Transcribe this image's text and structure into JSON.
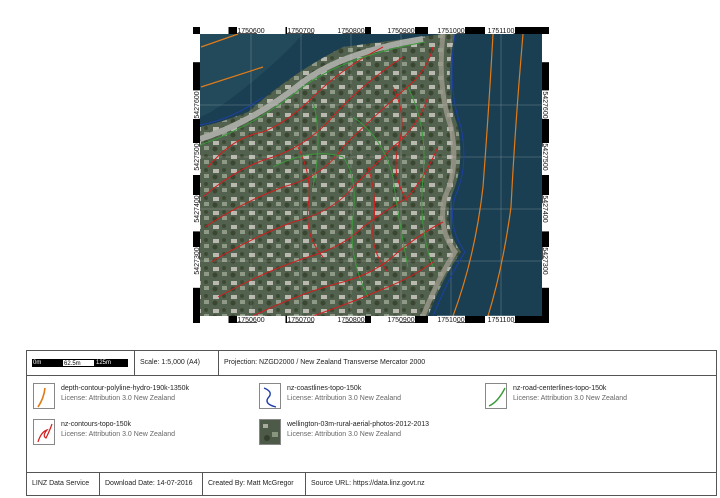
{
  "map": {
    "x_ticks": [
      "1750600",
      "1750700",
      "1750800",
      "1750900",
      "1751000",
      "1751100"
    ],
    "y_ticks": [
      "5427600",
      "5427500",
      "5427400",
      "5427300"
    ]
  },
  "scale_bar": {
    "labels": [
      "0m",
      "62.5m",
      "125m"
    ]
  },
  "scale_text": "Scale: 1:5,000 (A4)",
  "projection_text": "Projection: NZGD2000 / New Zealand Transverse Mercator 2000",
  "legend": [
    {
      "name": "depth-contour-polyline-hydro-190k-1350k",
      "license": "License: Attribution 3.0 New Zealand",
      "icon": "orange-line-icon",
      "color": "#e07b1a"
    },
    {
      "name": "nz-coastlines-topo-150k",
      "license": "License: Attribution 3.0 New Zealand",
      "icon": "blue-line-icon",
      "color": "#1f3fa8"
    },
    {
      "name": "nz-road-centerlines-topo-150k",
      "license": "License: Attribution 3.0 New Zealand",
      "icon": "green-line-icon",
      "color": "#3a9a3a"
    },
    {
      "name": "nz-contours-topo-150k",
      "license": "License: Attribution 3.0 New Zealand",
      "icon": "red-line-icon",
      "color": "#d21e1e"
    },
    {
      "name": "wellington-03m-rural-aerial-photos-2012-2013",
      "license": "License: Attribution 3.0 New Zealand",
      "icon": "aerial-photo-icon",
      "color": "#4d5a48"
    }
  ],
  "footer": {
    "service": "LINZ Data Service",
    "download_date": "Download Date: 14-07-2016",
    "created_by": "Created By: Matt McGregor",
    "source_url": "Source URL: https://data.linz.govt.nz"
  }
}
